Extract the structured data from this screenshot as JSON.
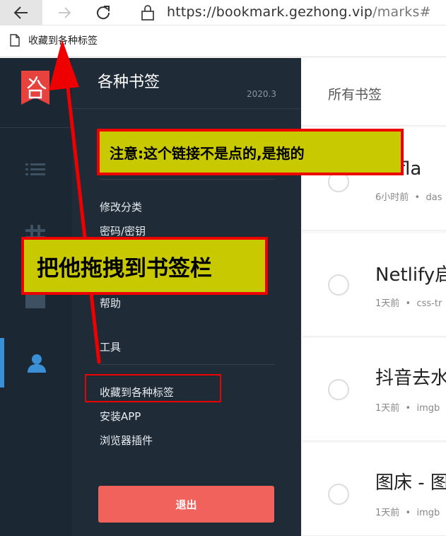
{
  "browser": {
    "url_base": "https://bookmark.gezhong.vip",
    "url_path": "/marks#"
  },
  "bookmarks_bar": {
    "item_label": "收藏到各种标签"
  },
  "sidebar": {
    "title": "各种书签",
    "version": "2020.3",
    "menu": {
      "edit_category": "修改分类",
      "password": "密码/密钥",
      "help": "帮助",
      "tools": "工具",
      "bookmarklet": "收藏到各种标签",
      "install_app": "安装APP",
      "browser_plugin": "浏览器插件"
    },
    "logout_label": "退出"
  },
  "content": {
    "title": "所有书签",
    "cards": [
      {
        "title": "udfla",
        "time": "6小时前",
        "tag": "das"
      },
      {
        "title": "Netlify启",
        "time": "1天前",
        "tag": "css-tr"
      },
      {
        "title": "抖音去水",
        "time": "1天前",
        "tag": "imgb"
      },
      {
        "title": "图床 - 图",
        "time": "1天前",
        "tag": "imgb"
      }
    ]
  },
  "annotations": {
    "note_drag": "注意:这个链接不是点的,是拖的",
    "note_drag_to_bar": "把他拖拽到书签栏"
  },
  "colors": {
    "rail_bg": "#1b2733",
    "panel_bg": "#1f2c38",
    "accent_red": "#f2625d",
    "annotation_red": "#e00000",
    "annotation_yellow": "#c9c900",
    "active_blue": "#3b8fd6"
  },
  "icons": {
    "back": "arrow-left-icon",
    "forward": "arrow-right-icon",
    "reload": "reload-icon",
    "lock": "lock-icon",
    "page": "page-icon",
    "list": "list-icon",
    "hash": "hash-icon",
    "folder": "folder-icon",
    "user": "user-icon"
  }
}
